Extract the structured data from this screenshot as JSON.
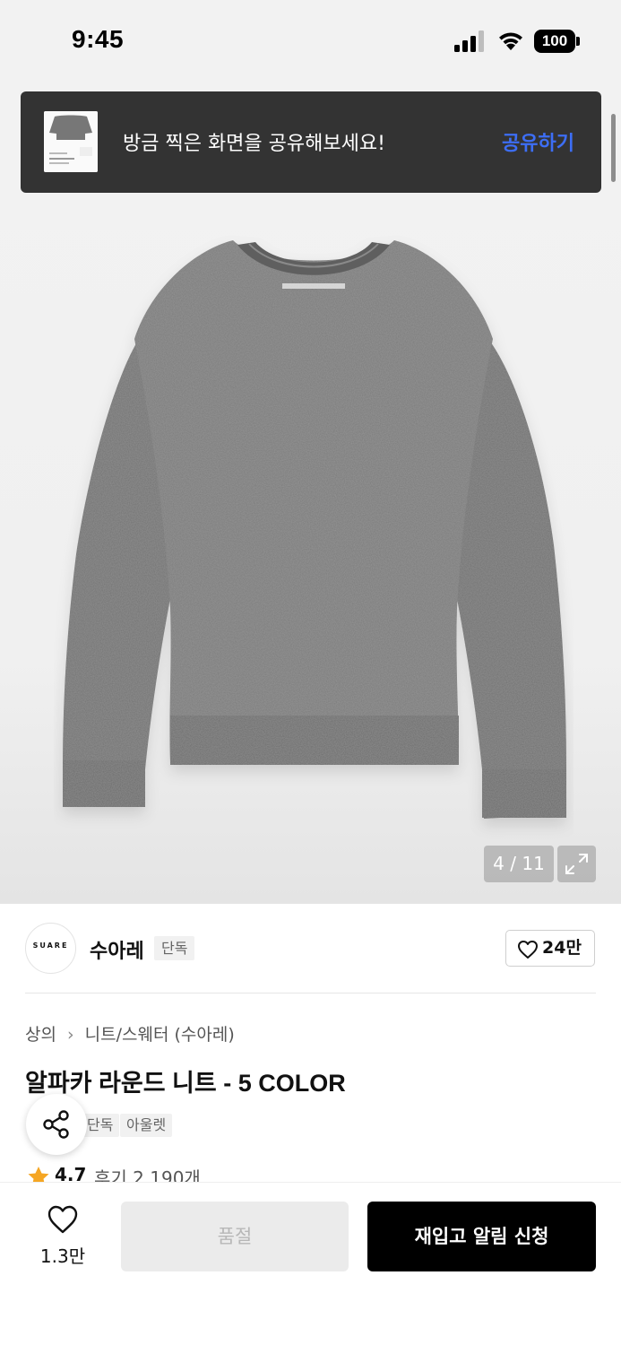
{
  "status_bar": {
    "time": "9:45",
    "battery": "100"
  },
  "toast": {
    "message": "방금 찍은 화면을 공유해보세요!",
    "action_label": "공유하기"
  },
  "gallery": {
    "counter": "4 / 11"
  },
  "brand": {
    "logo_text": "SUARE",
    "name": "수아레",
    "badge": "단독",
    "likes": "24만"
  },
  "breadcrumb": {
    "items": [
      "상의",
      "니트/스웨터 (수아레)"
    ]
  },
  "product": {
    "title": "알파카 라운드 니트 - 5 COLOR",
    "tags": [
      "단독",
      "아울렛"
    ],
    "rating": "4.7",
    "reviews": "후기 2,190개"
  },
  "bottom": {
    "wish_count": "1.3만",
    "soldout_label": "품절",
    "restock_label": "재입고 알림 신청"
  },
  "colors": {
    "accent_link": "#3d6ef5",
    "toast_bg": "#333333",
    "star": "#f5a623",
    "primary_button": "#000000"
  }
}
